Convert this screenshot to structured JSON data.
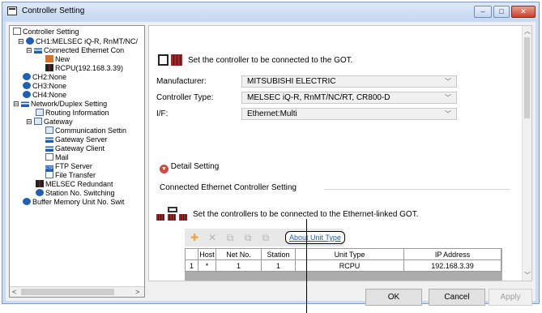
{
  "window": {
    "title": "Controller Setting"
  },
  "tree": {
    "items": [
      {
        "label": "Controller Setting",
        "icon": "controller-setting-icon"
      },
      {
        "label": "CH1:MELSEC iQ-R, RnMT/NC/",
        "icon": "channel-icon"
      },
      {
        "label": "Connected Ethernet Con",
        "icon": "network-icon"
      },
      {
        "label": "New",
        "icon": "new-icon"
      },
      {
        "label": "RCPU(192.168.3.39)",
        "icon": "rcpu-icon"
      },
      {
        "label": "CH2:None",
        "icon": "channel-icon"
      },
      {
        "label": "CH3:None",
        "icon": "channel-icon"
      },
      {
        "label": "CH4:None",
        "icon": "channel-icon"
      },
      {
        "label": "Network/Duplex Setting",
        "icon": "network-icon"
      },
      {
        "label": "Routing Information",
        "icon": "routing-icon"
      },
      {
        "label": "Gateway",
        "icon": "gateway-icon"
      },
      {
        "label": "Communication Settin",
        "icon": "communication-icon"
      },
      {
        "label": "Gateway Server",
        "icon": "gateway-server-icon"
      },
      {
        "label": "Gateway Client",
        "icon": "gateway-client-icon"
      },
      {
        "label": "Mail",
        "icon": "mail-icon"
      },
      {
        "label": "FTP Server",
        "icon": "ftp-icon"
      },
      {
        "label": "File Transfer",
        "icon": "file-transfer-icon"
      },
      {
        "label": "MELSEC Redundant",
        "icon": "redundant-icon"
      },
      {
        "label": "Station No. Switching",
        "icon": "station-switch-icon"
      },
      {
        "label": "Buffer Memory Unit No. Swit",
        "icon": "buffer-memory-icon"
      }
    ],
    "ftp_badge": "FTP"
  },
  "main": {
    "heading": "Set the controller to be connected to the GOT.",
    "fields": [
      {
        "label": "Manufacturer:",
        "value": "MITSUBISHI ELECTRIC"
      },
      {
        "label": "Controller Type:",
        "value": "MELSEC iQ-R, RnMT/NC/RT, CR800-D"
      },
      {
        "label": "I/F:",
        "value": "Ethernet:Multi"
      }
    ],
    "detail_setting": "Detail Setting",
    "group_title": "Connected Ethernet Controller Setting",
    "eth_heading": "Set the controllers to be connected to the Ethernet-linked GOT.",
    "about_link": "About Unit Type",
    "table": {
      "headers": [
        "",
        "Host",
        "Net No.",
        "Station",
        "Unit Type",
        "IP Address"
      ],
      "rows": [
        [
          "1",
          "*",
          "1",
          "1",
          "RCPU",
          "192.168.3.39"
        ]
      ]
    }
  },
  "buttons": {
    "ok": "OK",
    "cancel": "Cancel",
    "apply": "Apply"
  },
  "colors": {
    "accent": "#1a5fb4",
    "brand_red": "#b01f1f"
  }
}
